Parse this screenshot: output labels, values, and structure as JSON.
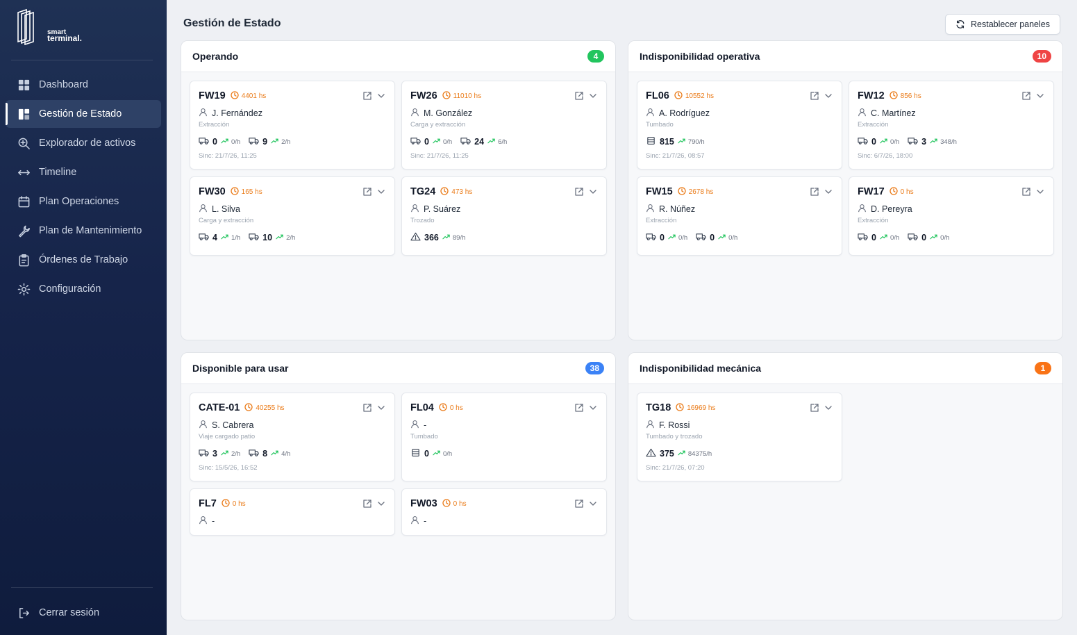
{
  "brand": {
    "line1": "smart",
    "line2": "terminal."
  },
  "nav": [
    {
      "label": "Dashboard",
      "icon": "grid-icon",
      "active": false
    },
    {
      "label": "Gestión de Estado",
      "icon": "layout-icon",
      "active": true
    },
    {
      "label": "Explorador de activos",
      "icon": "zoom-in-icon",
      "active": false
    },
    {
      "label": "Timeline",
      "icon": "arrows-horizontal-icon",
      "active": false
    },
    {
      "label": "Plan Operaciones",
      "icon": "calendar-icon",
      "active": false
    },
    {
      "label": "Plan de Mantenimiento",
      "icon": "wrench-icon",
      "active": false
    },
    {
      "label": "Órdenes de Trabajo",
      "icon": "clipboard-icon",
      "active": false
    },
    {
      "label": "Configuración",
      "icon": "sun-gear-icon",
      "active": false
    }
  ],
  "logout": {
    "label": "Cerrar sesión",
    "icon": "logout-icon"
  },
  "header": {
    "title": "Gestión de Estado",
    "reset_label": "Restablecer paneles"
  },
  "colors": {
    "green": "#22c55e",
    "red": "#ef4444",
    "blue": "#3b82f6",
    "orange": "#f97316",
    "hours": "#ea7a17"
  },
  "panels": [
    {
      "title": "Operando",
      "count": "4",
      "color": "#22c55e",
      "cards": [
        {
          "id": "FW19",
          "hours": "4401 hs",
          "operator": "J. Fernández",
          "task": "Extracción",
          "metrics": [
            {
              "icon": "truck-icon",
              "value": "0",
              "rate": "0/h"
            },
            {
              "icon": "truck-icon",
              "value": "9",
              "rate": "2/h"
            }
          ],
          "sync": "Sinc: 21/7/26, 11:25"
        },
        {
          "id": "FW26",
          "hours": "11010 hs",
          "operator": "M. González",
          "task": "Carga y extracción",
          "metrics": [
            {
              "icon": "truck-icon",
              "value": "0",
              "rate": "0/h"
            },
            {
              "icon": "truck-icon",
              "value": "24",
              "rate": "6/h"
            }
          ],
          "sync": "Sinc: 21/7/26, 11:25"
        },
        {
          "id": "FW30",
          "hours": "165 hs",
          "operator": "L. Silva",
          "task": "Carga y extracción",
          "metrics": [
            {
              "icon": "truck-icon",
              "value": "4",
              "rate": "1/h"
            },
            {
              "icon": "truck-icon",
              "value": "10",
              "rate": "2/h"
            }
          ],
          "sync": ""
        },
        {
          "id": "TG24",
          "hours": "473 hs",
          "operator": "P. Suárez",
          "task": "Trozado",
          "metrics": [
            {
              "icon": "warning-icon",
              "value": "366",
              "rate": "89/h"
            }
          ],
          "sync": ""
        }
      ]
    },
    {
      "title": "Indisponibilidad operativa",
      "count": "10",
      "color": "#ef4444",
      "cards": [
        {
          "id": "FL06",
          "hours": "10552 hs",
          "operator": "A. Rodríguez",
          "task": "Tumbado",
          "metrics": [
            {
              "icon": "stack-icon",
              "value": "815",
              "rate": "790/h"
            }
          ],
          "sync": "Sinc: 21/7/26, 08:57"
        },
        {
          "id": "FW12",
          "hours": "856 hs",
          "operator": "C. Martínez",
          "task": "Extracción",
          "metrics": [
            {
              "icon": "truck-icon",
              "value": "0",
              "rate": "0/h"
            },
            {
              "icon": "truck-icon",
              "value": "3",
              "rate": "348/h"
            }
          ],
          "sync": "Sinc: 6/7/26, 18:00"
        },
        {
          "id": "FW15",
          "hours": "2678 hs",
          "operator": "R. Núñez",
          "task": "Extracción",
          "metrics": [
            {
              "icon": "truck-icon",
              "value": "0",
              "rate": "0/h"
            },
            {
              "icon": "truck-icon",
              "value": "0",
              "rate": "0/h"
            }
          ],
          "sync": ""
        },
        {
          "id": "FW17",
          "hours": "0 hs",
          "operator": "D. Pereyra",
          "task": "Extracción",
          "metrics": [
            {
              "icon": "truck-icon",
              "value": "0",
              "rate": "0/h"
            },
            {
              "icon": "truck-icon",
              "value": "0",
              "rate": "0/h"
            }
          ],
          "sync": ""
        }
      ]
    },
    {
      "title": "Disponible para usar",
      "count": "38",
      "color": "#3b82f6",
      "cards": [
        {
          "id": "CATE-01",
          "hours": "40255 hs",
          "operator": "S. Cabrera",
          "task": "Viaje cargado patio",
          "metrics": [
            {
              "icon": "truck-icon",
              "value": "3",
              "rate": "2/h"
            },
            {
              "icon": "truck-icon",
              "value": "8",
              "rate": "4/h"
            }
          ],
          "sync": "Sinc: 15/5/26, 16:52"
        },
        {
          "id": "FL04",
          "hours": "0 hs",
          "operator": "-",
          "task": "Tumbado",
          "metrics": [
            {
              "icon": "stack-icon",
              "value": "0",
              "rate": "0/h"
            }
          ],
          "sync": ""
        },
        {
          "id": "FL7",
          "hours": "0 hs",
          "operator": "-",
          "task": "",
          "metrics": [],
          "sync": ""
        },
        {
          "id": "FW03",
          "hours": "0 hs",
          "operator": "-",
          "task": "",
          "metrics": [],
          "sync": ""
        }
      ]
    },
    {
      "title": "Indisponibilidad mecánica",
      "count": "1",
      "color": "#f97316",
      "cards": [
        {
          "id": "TG18",
          "hours": "16969 hs",
          "operator": "F. Rossi",
          "task": "Tumbado y trozado",
          "metrics": [
            {
              "icon": "warning-icon",
              "value": "375",
              "rate": "84375/h"
            }
          ],
          "sync": "Sinc: 21/7/26, 07:20"
        }
      ]
    }
  ]
}
